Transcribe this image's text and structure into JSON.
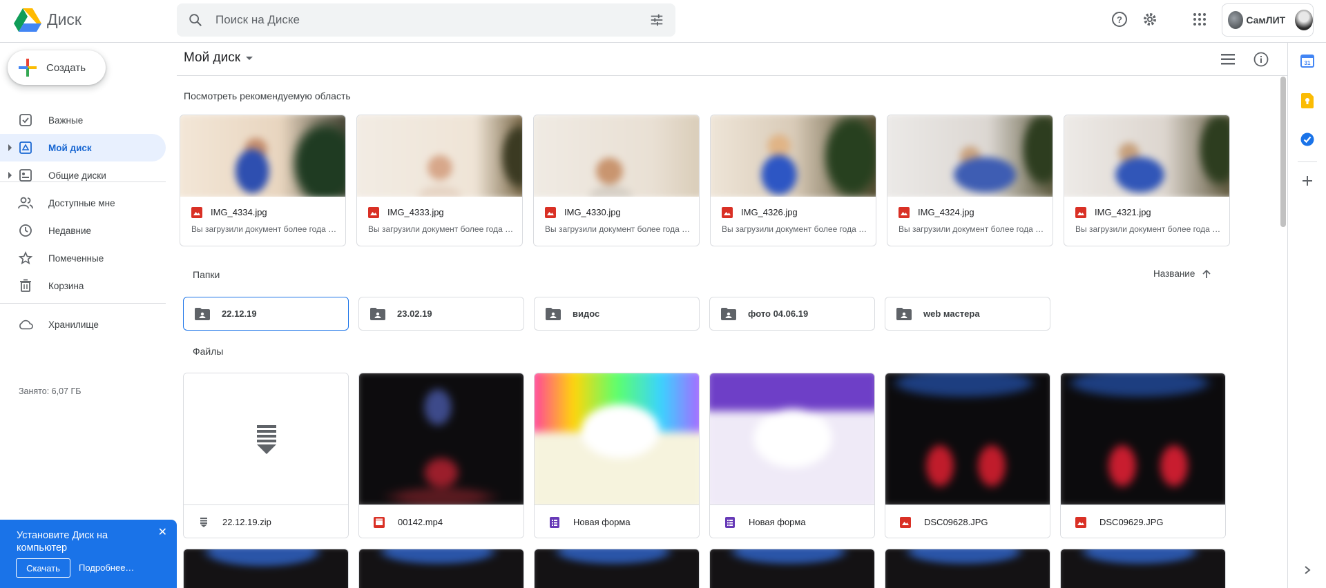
{
  "app": {
    "name": "Диск"
  },
  "search": {
    "placeholder": "Поиск на Диске"
  },
  "account": {
    "org_name": "СамЛИТ"
  },
  "sidebar": {
    "create_label": "Создать",
    "items": [
      {
        "label": "Важные",
        "icon": "priority-icon"
      },
      {
        "label": "Мой диск",
        "icon": "my-drive-icon",
        "active": true
      },
      {
        "label": "Общие диски",
        "icon": "shared-drives-icon"
      },
      {
        "label": "Доступные мне",
        "icon": "shared-with-me-icon"
      },
      {
        "label": "Недавние",
        "icon": "recent-icon"
      },
      {
        "label": "Помеченные",
        "icon": "starred-icon"
      },
      {
        "label": "Корзина",
        "icon": "trash-icon"
      },
      {
        "label": "Хранилище",
        "icon": "cloud-icon"
      }
    ],
    "storage_used": "Занято: 6,07 ГБ"
  },
  "install_banner": {
    "title": "Установите Диск на компьютер",
    "download_label": "Скачать",
    "more_label": "Подробнее…"
  },
  "toolbar": {
    "breadcrumb": "Мой диск"
  },
  "suggested": {
    "title": "Посмотреть рекомендуемую область",
    "items": [
      {
        "name": "IMG_4334.jpg",
        "subtitle": "Вы загрузили документ более года назад"
      },
      {
        "name": "IMG_4333.jpg",
        "subtitle": "Вы загрузили документ более года назад"
      },
      {
        "name": "IMG_4330.jpg",
        "subtitle": "Вы загрузили документ более года назад"
      },
      {
        "name": "IMG_4326.jpg",
        "subtitle": "Вы загрузили документ более года назад"
      },
      {
        "name": "IMG_4324.jpg",
        "subtitle": "Вы загрузили документ более года назад"
      },
      {
        "name": "IMG_4321.jpg",
        "subtitle": "Вы загрузили документ более года назад"
      }
    ]
  },
  "folders": {
    "title": "Папки",
    "sort_label": "Название",
    "items": [
      "22.12.19",
      "23.02.19",
      "видос",
      "фото 04.06.19",
      "web мастера"
    ]
  },
  "files": {
    "title": "Файлы",
    "items": [
      {
        "name": "22.12.19.zip",
        "type": "zip"
      },
      {
        "name": "00142.mp4",
        "type": "video"
      },
      {
        "name": "Новая форма",
        "type": "form"
      },
      {
        "name": "Новая форма",
        "type": "form"
      },
      {
        "name": "DSC09628.JPG",
        "type": "image"
      },
      {
        "name": "DSC09629.JPG",
        "type": "image"
      }
    ]
  },
  "colors": {
    "accent": "#1a73e8",
    "active_nav_bg": "#e8f0fe",
    "image_icon": "#d93025",
    "video_icon": "#d93025",
    "form_icon": "#673ab7"
  }
}
